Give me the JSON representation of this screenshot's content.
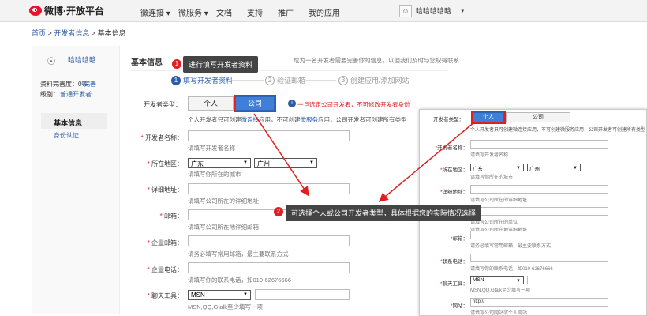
{
  "header": {
    "logo_text": "微博·开放平台",
    "nav": [
      "微连接 ▾",
      "微服务 ▾",
      "文档",
      "支持",
      "推广",
      "我的应用"
    ],
    "user_name": "晗晗晗晗晗...",
    "user_caret": "▾"
  },
  "breadcrumb": {
    "home": "首页",
    "sep1": ">",
    "dev": "开发者信息",
    "sep2": ">",
    "current": "基本信息"
  },
  "sidebar": {
    "username": "晗晗晗晗",
    "completion": "资料完善度：0%",
    "completion_link": "完善",
    "level_label": "级别：",
    "level_value": "普通开发者",
    "menu_active": "基本信息",
    "menu_item": "身份认证"
  },
  "main": {
    "section_title": "基本信息",
    "intro": "成为一名开发者需要完善你的信息，以便我们及时与您取得联系",
    "steps": [
      {
        "num": "1",
        "label": "填写开发者资料"
      },
      {
        "num": "2",
        "label": "验证邮箱"
      },
      {
        "num": "3",
        "label": "创建应用/添加网站"
      }
    ],
    "type_label": "开发者类型：",
    "tab_personal": "个人",
    "tab_company": "公司",
    "warn_icon": "i",
    "warning": "一旦选定公司开发者，不可修改开发者身份",
    "type_desc_a": "个人开发者只可创建",
    "type_desc_link1": "微连接",
    "type_desc_b": "应用，不可创建",
    "type_desc_link2": "微服务",
    "type_desc_c": "应用，公司开发者可创建所有类型",
    "fields": {
      "name_label": "开发者名称：",
      "name_hint": "请填写开发者名称",
      "region_label": "所在地区：",
      "province": "广东",
      "city": "广州",
      "region_hint": "请填写你所在的城市",
      "address_label": "详细地址：",
      "address_hint": "请填写公司所在的详细地址",
      "email_label": "邮箱：",
      "email_hint": "请填写公司所在地详细邮箱",
      "biz_email_label": "企业邮箱：",
      "biz_email_hint": "请务必填写常用邮箱，最主要联系方式",
      "phone_label": "企业电话：",
      "phone_hint": "请填写你的联系电话，如010-62676666",
      "im_label": "聊天工具：",
      "im_value": "MSN",
      "im_hint": "MSN,QQ,Gtalk至少填写一项"
    }
  },
  "panel": {
    "type_label": "开发者类型：",
    "tab_personal": "个人",
    "tab_company": "公司",
    "type_desc": "个人开发者只可创建微连接应用，不可创建微服务应用，公司开发者可创建所有类型",
    "name_label": "开发者名称：",
    "name_hint": "请填写开发者名称",
    "region_label": "所在地区：",
    "province": "广东",
    "city": "广州",
    "region_hint": "请填写你所在的城市",
    "address_label": "详细地址：",
    "address_hint": "请填写公司所在的详细地址",
    "unit_hint": "请填写公司所在的单位",
    "company_hint": "请填写公司所在地详细地址",
    "email_label": "邮箱：",
    "email_hint": "请务必填写常用邮箱，最主要联系方式",
    "phone_label": "联系电话：",
    "phone_hint": "请填写你的联系电话，如010-62676666",
    "im_label": "聊天工具：",
    "im_value": "MSN",
    "im_hint": "MSN,QQ,Gtalk至少填写一项",
    "site_label": "网站：",
    "site_value": "http://",
    "site_hint": "请填写公司网站或个人网站"
  },
  "annotations": {
    "tip1_num": "1",
    "tip1": "进行填写开发者资料",
    "tip2_num": "2",
    "tip2": "可选择个人或公司开发者类型，具体根据您的实际情况选择"
  },
  "colors": {
    "accent": "#2a5caa",
    "red": "#e02020",
    "tab_active": "#3f7fd7",
    "tip_bg": "#444444"
  }
}
